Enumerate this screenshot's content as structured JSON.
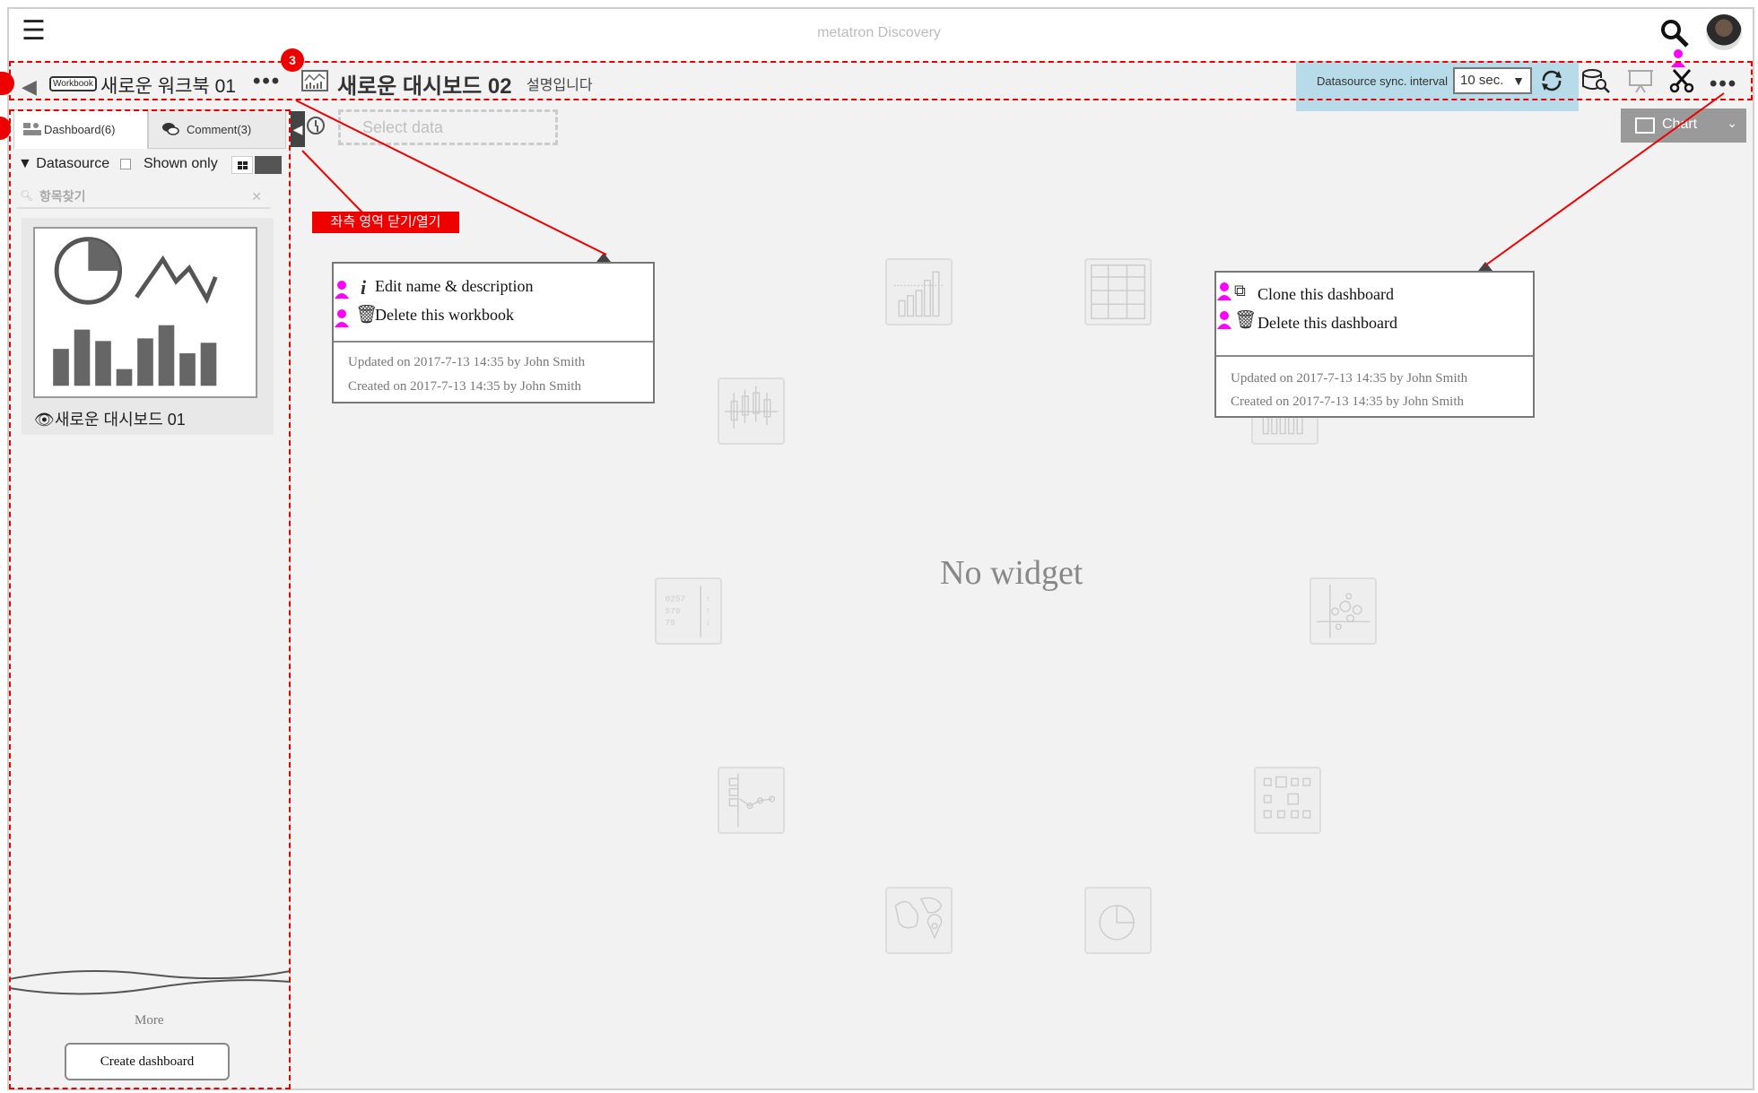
{
  "app": {
    "title": "metatron Discovery"
  },
  "workbook": {
    "badge": "Workbook",
    "title": "새로운 워크북 01",
    "more": "•••"
  },
  "dashboard": {
    "title": "새로운 대시보드 02",
    "description": "설명입니다"
  },
  "sync": {
    "label": "Datasource sync. interval",
    "value": "10 sec."
  },
  "toolbar": {
    "more": "•••"
  },
  "tabs": [
    {
      "label": "Dashboard(6)"
    },
    {
      "label": "Comment(3)"
    }
  ],
  "filter": {
    "datasource_label": "Datasource",
    "shown_only_label": "Shown only",
    "search_placeholder": "항목찾기"
  },
  "select_data": {
    "placeholder": "Select data"
  },
  "cards": [
    {
      "title": "새로운 대시보드 01"
    }
  ],
  "sidebar": {
    "more": "More",
    "create_button": "Create dashboard"
  },
  "chart_button": {
    "label": "Chart"
  },
  "annotation": {
    "toggle_label": "좌측 영역 닫기/열기",
    "marker_3": "3"
  },
  "workbook_menu": {
    "items": [
      "Edit name & description",
      "Delete this workbook"
    ],
    "updated": "Updated on 2017-7-13 14:35 by John Smith",
    "created": "Created on 2017-7-13 14:35 by John Smith"
  },
  "dashboard_menu": {
    "items": [
      "Clone this dashboard",
      "Delete this dashboard"
    ],
    "updated": "Updated on 2017-7-13 14:35 by John Smith",
    "created": "Created on 2017-7-13 14:35 by John Smith"
  },
  "canvas": {
    "empty_message": "No widget"
  },
  "colors": {
    "annotation_red": "#e00000",
    "accent_magenta": "#ff00ff",
    "sync_highlight": "#b7dbe8"
  }
}
